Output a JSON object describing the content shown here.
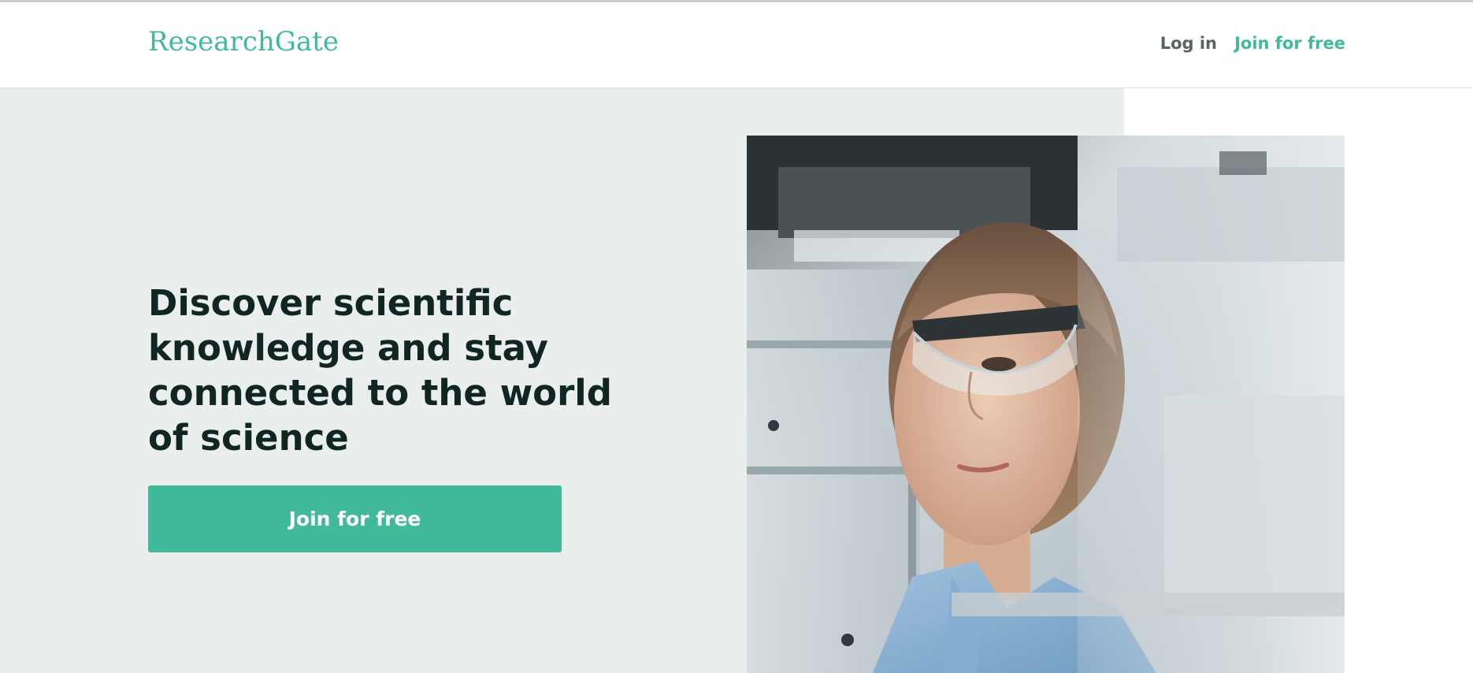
{
  "header": {
    "logo_text": "ResearchGate",
    "login_label": "Log in",
    "join_label": "Join for free"
  },
  "hero": {
    "headline": "Discover scientific knowledge and stay connected to the world of science",
    "cta_label": "Join for free",
    "image_subject": "scientist-with-safety-goggles"
  },
  "colors": {
    "accent": "#40ba9b",
    "hero_background": "#eaeeed",
    "headline_text": "#0f2623",
    "nav_text": "#5a6264"
  }
}
